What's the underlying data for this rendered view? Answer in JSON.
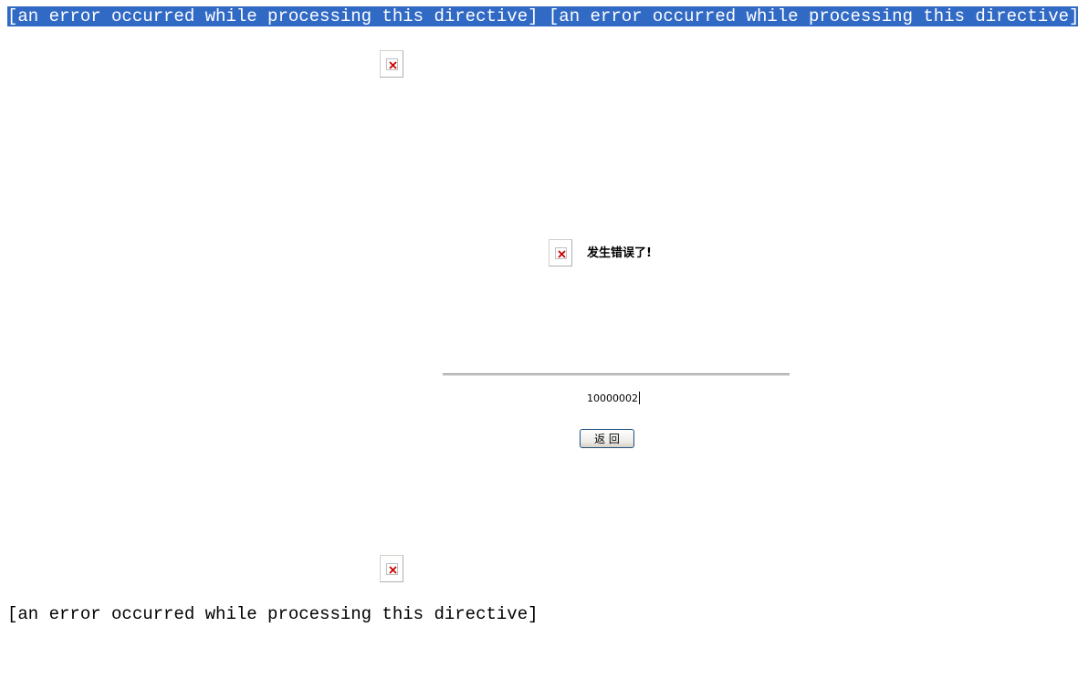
{
  "top_message": {
    "part1": "[an error occurred while processing this directive]",
    "separator": " ",
    "part2": "[an error occurred while processing this directive]"
  },
  "content": {
    "title": "发生错误了!",
    "error_code": "10000002",
    "back_button_label": "返 回"
  },
  "bottom_message": "[an error occurred while processing this directive]",
  "icons": {
    "broken_image": "broken-image-icon"
  },
  "colors": {
    "selection_highlight": "#316ac5",
    "broken_x": "#cc0000"
  }
}
